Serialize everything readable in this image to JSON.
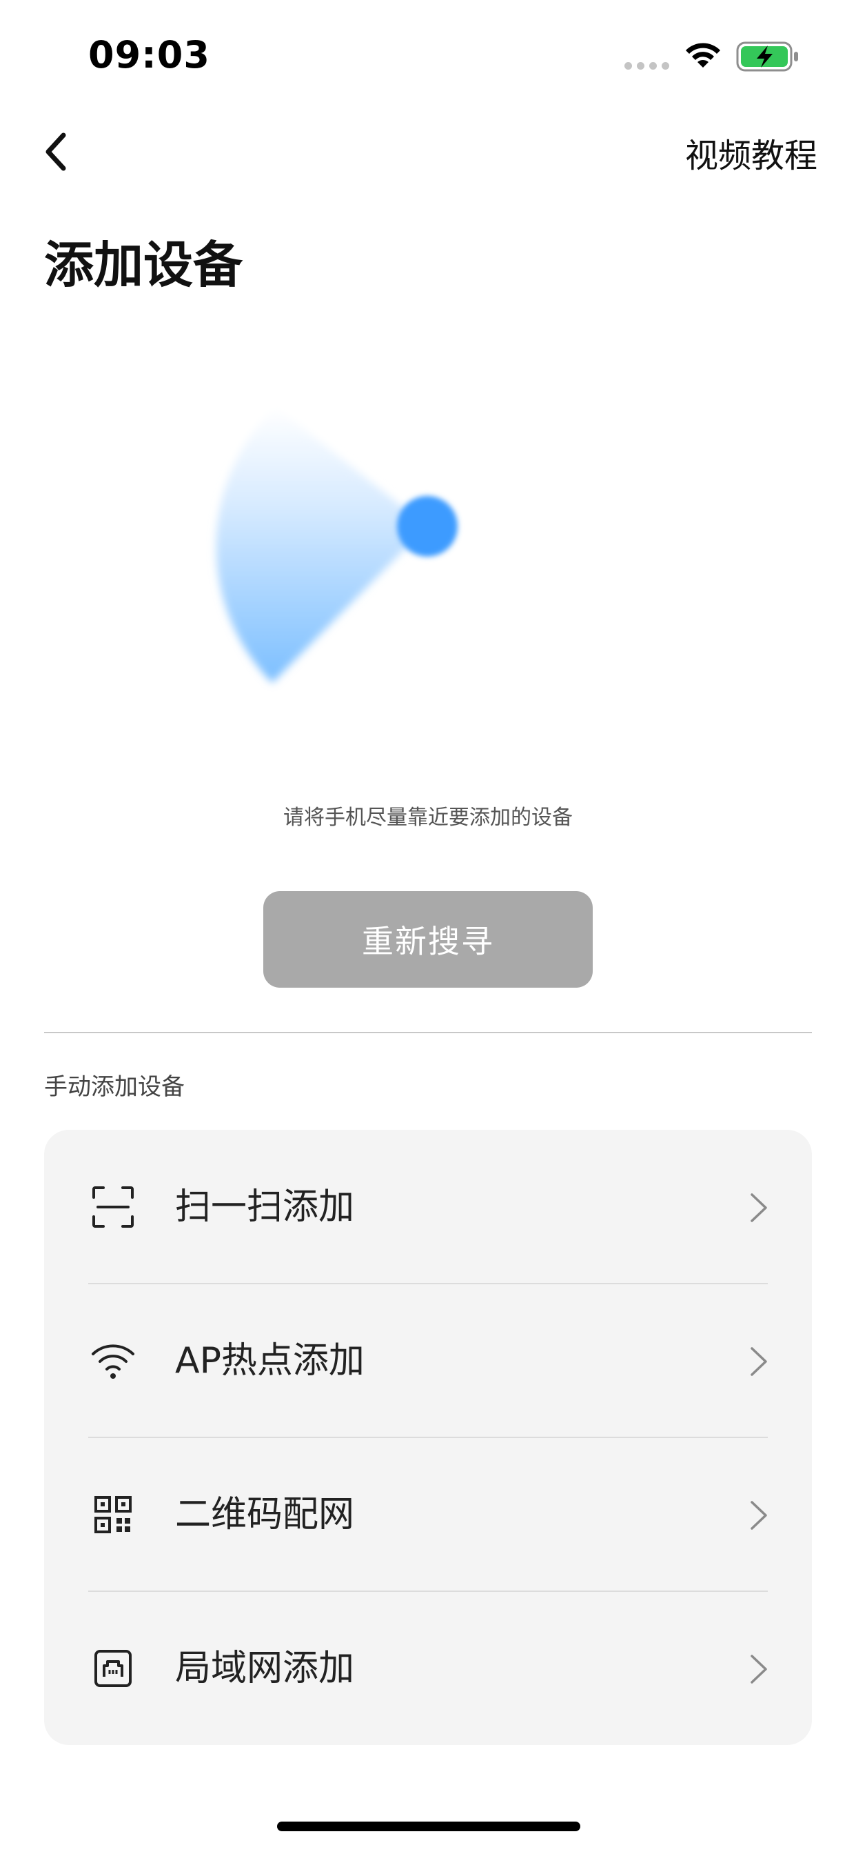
{
  "status_bar": {
    "time": "09:03",
    "icons": [
      "signal-dots-icon",
      "wifi-icon",
      "battery-charging-icon"
    ],
    "battery_color": "#34c759"
  },
  "nav": {
    "back_icon": "chevron-left-icon",
    "video_tutorial_label": "视频教程"
  },
  "page": {
    "title": "添加设备"
  },
  "scan": {
    "hint": "请将手机尽量靠近要添加的设备",
    "research_button_label": "重新搜寻",
    "accent_color": "#3d9bff"
  },
  "manual": {
    "section_title": "手动添加设备",
    "items": [
      {
        "label": "扫一扫添加",
        "icon": "scan-icon"
      },
      {
        "label": "AP热点添加",
        "icon": "wifi-icon"
      },
      {
        "label": "二维码配网",
        "icon": "qr-code-icon"
      },
      {
        "label": "局域网添加",
        "icon": "ethernet-port-icon"
      }
    ]
  },
  "colors": {
    "button_disabled_bg": "#a9a9a9",
    "card_bg": "#f4f4f4"
  }
}
